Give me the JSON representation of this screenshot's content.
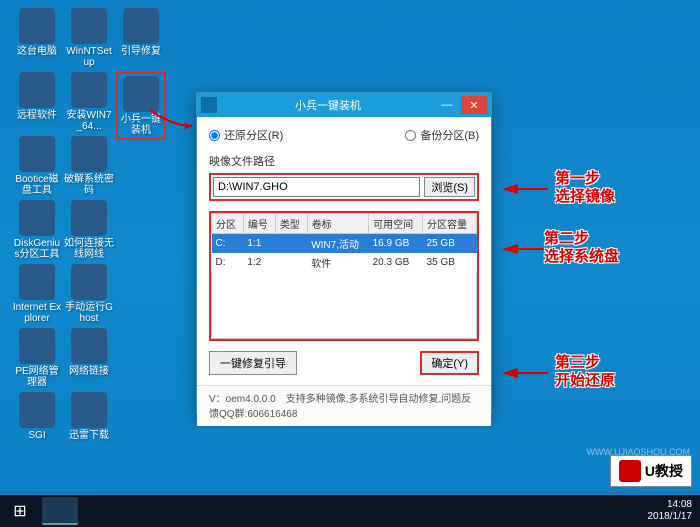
{
  "desktop_icons": [
    {
      "label": "这台电脑",
      "col": 0,
      "row": 0
    },
    {
      "label": "WinNTSetup",
      "col": 1,
      "row": 0
    },
    {
      "label": "引导修复",
      "col": 2,
      "row": 0
    },
    {
      "label": "远程软件",
      "col": 0,
      "row": 1
    },
    {
      "label": "安装WIN7_64...",
      "col": 1,
      "row": 1
    },
    {
      "label": "小兵一键装机",
      "col": 2,
      "row": 1,
      "selected": true
    },
    {
      "label": "Bootice磁盘工具",
      "col": 0,
      "row": 2
    },
    {
      "label": "破解系统密码",
      "col": 1,
      "row": 2
    },
    {
      "label": "DiskGenius分区工具",
      "col": 0,
      "row": 3
    },
    {
      "label": "如何连接无线网线",
      "col": 1,
      "row": 3
    },
    {
      "label": "Internet Explorer",
      "col": 0,
      "row": 4
    },
    {
      "label": "手动运行Ghost",
      "col": 1,
      "row": 4
    },
    {
      "label": "PE网络管理器",
      "col": 0,
      "row": 5
    },
    {
      "label": "网络链接",
      "col": 1,
      "row": 5
    },
    {
      "label": "SGI",
      "col": 0,
      "row": 6
    },
    {
      "label": "迅雷下载",
      "col": 1,
      "row": 6
    }
  ],
  "dialog": {
    "title": "小兵一键装机",
    "radio_restore": "还原分区(R)",
    "radio_backup": "备份分区(B)",
    "path_label": "映像文件路径",
    "path_value": "D:\\WIN7.GHO",
    "browse": "浏览(S)",
    "cols": [
      "分区",
      "编号",
      "类型",
      "卷标",
      "可用空间",
      "分区容量"
    ],
    "rows": [
      {
        "p": "C:",
        "n": "1:1",
        "t": "",
        "v": "WIN7,活动",
        "free": "16.9 GB",
        "cap": "25 GB",
        "sel": true
      },
      {
        "p": "D:",
        "n": "1:2",
        "t": "",
        "v": "软件",
        "free": "20.3 GB",
        "cap": "35 GB",
        "sel": false
      }
    ],
    "repair": "一键修复引导",
    "ok": "确定(Y)",
    "footer": "V：oem4.0.0.0　支持多种镜像,多系统引导自动修复,问题反馈QQ群:606616468"
  },
  "annotations": {
    "a1t": "第一步",
    "a1b": "选择镜像",
    "a2t": "第二步",
    "a2b": "选择系统盘",
    "a3t": "第三步",
    "a3b": "开始还原"
  },
  "taskbar": {
    "time": "14:08",
    "date": "2018/1/17"
  },
  "watermark": "U教授",
  "small_wm": "WWW.UJIAOSHOU.COM"
}
